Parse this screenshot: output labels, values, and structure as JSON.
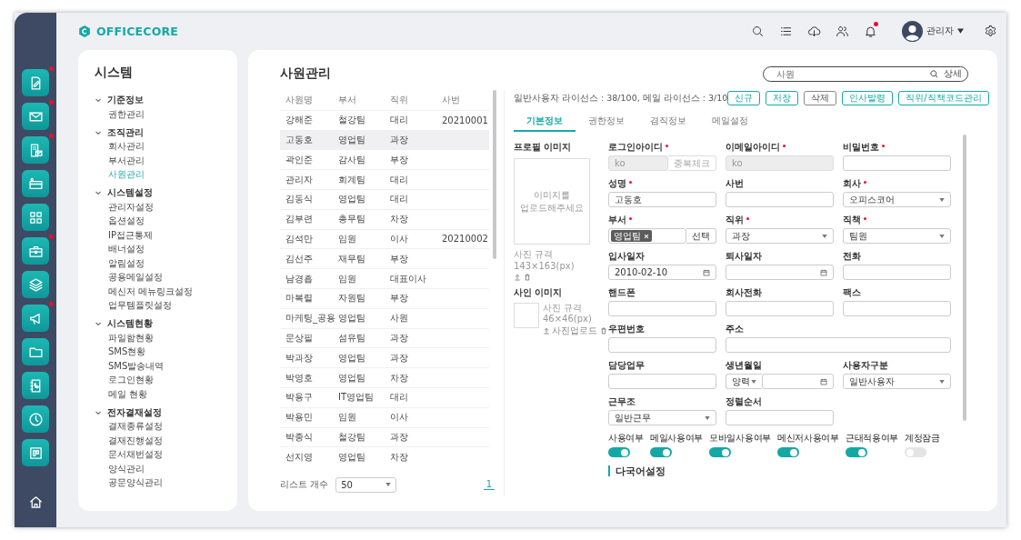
{
  "rail": [
    {
      "kind": "note",
      "badge": true
    },
    {
      "kind": "mail",
      "badge": true
    },
    {
      "kind": "building-mail",
      "badge": true
    },
    {
      "kind": "card",
      "badge": false
    },
    {
      "kind": "apps",
      "badge": false
    },
    {
      "kind": "briefcase",
      "badge": true
    },
    {
      "kind": "layers",
      "badge": false
    },
    {
      "kind": "megaphone",
      "badge": true
    },
    {
      "kind": "folder",
      "badge": false
    },
    {
      "kind": "contacts",
      "badge": false
    },
    {
      "kind": "clock",
      "badge": false
    },
    {
      "kind": "board",
      "badge": false
    }
  ],
  "header": {
    "logo": "OFFICECORE",
    "bell_badge": true,
    "user": "관리자"
  },
  "sidebar": {
    "title": "시스템",
    "items": [
      {
        "label": "기준정보",
        "expanded": true,
        "children": [
          {
            "label": "권한관리",
            "selected": false
          }
        ]
      },
      {
        "label": "조직관리",
        "expanded": true,
        "children": [
          {
            "label": "회사관리",
            "selected": false
          },
          {
            "label": "부서관리",
            "selected": false
          },
          {
            "label": "사원관리",
            "selected": true
          }
        ]
      },
      {
        "label": "시스템설정",
        "expanded": true,
        "children": [
          {
            "label": "관리자설정",
            "selected": false
          },
          {
            "label": "옵션설정",
            "selected": false
          },
          {
            "label": "IP접근통제",
            "selected": false
          },
          {
            "label": "배너설정",
            "selected": false
          },
          {
            "label": "알림설정",
            "selected": false
          },
          {
            "label": "공용메일설정",
            "selected": false
          },
          {
            "label": "메신저 메뉴링크설정",
            "selected": false
          },
          {
            "label": "업무템플릿설정",
            "selected": false
          }
        ]
      },
      {
        "label": "시스템현황",
        "expanded": true,
        "children": [
          {
            "label": "파일함현황",
            "selected": false
          },
          {
            "label": "SMS현황",
            "selected": false
          },
          {
            "label": "SMS발송내역",
            "selected": false
          },
          {
            "label": "로그인현황",
            "selected": false
          },
          {
            "label": "메일 현황",
            "selected": false
          }
        ]
      },
      {
        "label": "전자결재설정",
        "expanded": true,
        "children": [
          {
            "label": "결재종류설정",
            "selected": false
          },
          {
            "label": "결재진행설정",
            "selected": false
          },
          {
            "label": "문서채번설정",
            "selected": false
          },
          {
            "label": "양식관리",
            "selected": false
          },
          {
            "label": "공문양식관리",
            "selected": false
          }
        ]
      }
    ]
  },
  "page": {
    "title": "사원관리",
    "search": {
      "placeholder": "사원",
      "detail": "상세"
    }
  },
  "list": {
    "columns": [
      "사원명",
      "부서",
      "직위",
      "사번"
    ],
    "rows": [
      {
        "cells": [
          "강해준",
          "철강팀",
          "대리",
          "20210001"
        ],
        "selected": false
      },
      {
        "cells": [
          "고동호",
          "영업팀",
          "과장"
        ],
        "selected": true
      },
      {
        "cells": [
          "곽인준",
          "감사팀",
          "부장"
        ],
        "selected": false
      },
      {
        "cells": [
          "관리자",
          "회계팀",
          "대리"
        ],
        "selected": false
      },
      {
        "cells": [
          "김동식",
          "영업팀",
          "대리"
        ],
        "selected": false
      },
      {
        "cells": [
          "김부련",
          "총무팀",
          "차장"
        ],
        "selected": false
      },
      {
        "cells": [
          "김석만",
          "임원",
          "이사",
          "20210002"
        ],
        "selected": false
      },
      {
        "cells": [
          "김선주",
          "재무팀",
          "부장"
        ],
        "selected": false
      },
      {
        "cells": [
          "남경흡",
          "임원",
          "대표이사"
        ],
        "selected": false
      },
      {
        "cells": [
          "마복렬",
          "자원팀",
          "부장"
        ],
        "selected": false
      },
      {
        "cells": [
          "마케팅_공용",
          "영업팀",
          "사원"
        ],
        "selected": false
      },
      {
        "cells": [
          "문상필",
          "섬유팀",
          "과장"
        ],
        "selected": false
      },
      {
        "cells": [
          "박과장",
          "영업팀",
          "과장"
        ],
        "selected": false
      },
      {
        "cells": [
          "박영호",
          "영업팀",
          "차장"
        ],
        "selected": false
      },
      {
        "cells": [
          "박용구",
          "IT영업팀",
          "대리"
        ],
        "selected": false
      },
      {
        "cells": [
          "박용민",
          "임원",
          "이사"
        ],
        "selected": false
      },
      {
        "cells": [
          "박종식",
          "철강팀",
          "과장"
        ],
        "selected": false
      },
      {
        "cells": [
          "선지영",
          "영업팀",
          "차장"
        ],
        "selected": false
      }
    ],
    "footer": {
      "label": "리스트 개수",
      "page_size": "50",
      "pages": [
        {
          "label": "1",
          "selected": true
        }
      ]
    }
  },
  "form": {
    "license": "일반사용자 라이선스 : 38/100, 메일 라이선스 : 3/10",
    "buttons": [
      {
        "label": "신규",
        "kind": "accent"
      },
      {
        "label": "저장",
        "kind": "accent"
      },
      {
        "label": "삭제",
        "kind": "plain"
      },
      {
        "label": "인사발령",
        "kind": "accent"
      },
      {
        "label": "직위/직책코드관리",
        "kind": "accent"
      }
    ],
    "tabs": [
      {
        "label": "기본정보",
        "selected": true
      },
      {
        "label": "권한정보",
        "selected": false
      },
      {
        "label": "겸직정보",
        "selected": false
      },
      {
        "label": "메일설정",
        "selected": false
      }
    ],
    "profile": {
      "label": "프로필 이미지",
      "hint": "이미지를 업로드해주세요",
      "spec": "사진 규격 143×163(px)"
    },
    "sign": {
      "label": "사인 이미지",
      "spec": "사진 규격 46×46(px)",
      "upload": "사진업로드"
    },
    "fields": [
      {
        "label": "로그인아이디",
        "required": true,
        "kind": "id-check",
        "value": "ko",
        "disabled": true,
        "button": "중복체크"
      },
      {
        "label": "이메일아이디",
        "required": true,
        "kind": "text",
        "value": "ko",
        "disabled": true
      },
      {
        "label": "비밀번호",
        "required": true,
        "kind": "text",
        "disabled": false
      },
      {
        "label": "성명",
        "required": true,
        "kind": "text",
        "value": "고동호",
        "disabled": false
      },
      {
        "label": "사번",
        "required": false,
        "kind": "text",
        "disabled": false
      },
      {
        "label": "회사",
        "required": true,
        "kind": "select",
        "value": "오피스코어",
        "disabled": false
      },
      {
        "label": "부서",
        "required": true,
        "kind": "tag",
        "value": "영업팀",
        "button": "선택",
        "disabled": false
      },
      {
        "label": "직위",
        "required": true,
        "kind": "select",
        "value": "과장",
        "disabled": false
      },
      {
        "label": "직책",
        "required": true,
        "kind": "select",
        "value": "팀원",
        "disabled": false
      },
      {
        "label": "입사일자",
        "required": false,
        "kind": "date",
        "value": "2010-02-10",
        "disabled": false
      },
      {
        "label": "퇴사일자",
        "required": false,
        "kind": "date",
        "disabled": false
      },
      {
        "label": "전화",
        "required": false,
        "kind": "text",
        "disabled": false
      },
      {
        "label": "핸드폰",
        "required": false,
        "kind": "text",
        "disabled": false
      },
      {
        "label": "회사전화",
        "required": false,
        "kind": "text",
        "disabled": false
      },
      {
        "label": "팩스",
        "required": false,
        "kind": "text",
        "disabled": false
      },
      {
        "label": "우편번호",
        "required": false,
        "kind": "text",
        "disabled": false
      },
      {
        "label": "주소",
        "required": false,
        "kind": "long-text",
        "disabled": false
      },
      {
        "label": "담당업무",
        "required": false,
        "kind": "text",
        "disabled": false
      },
      {
        "label": "생년월일",
        "required": false,
        "kind": "calendar-date",
        "calendar": "양력",
        "disabled": false
      },
      {
        "label": "사용자구분",
        "required": false,
        "kind": "select",
        "value": "일반사용자",
        "disabled": false
      },
      {
        "label": "근무조",
        "required": false,
        "kind": "select",
        "value": "일반근무",
        "disabled": false
      },
      {
        "label": "정렬순서",
        "required": false,
        "kind": "text",
        "disabled": false
      }
    ],
    "toggles": [
      {
        "label": "사용여부",
        "on": true
      },
      {
        "label": "메일사용여부",
        "on": true
      },
      {
        "label": "모바일사용여부",
        "on": true
      },
      {
        "label": "메신저사용여부",
        "on": true
      },
      {
        "label": "근태적용여부",
        "on": true
      },
      {
        "label": "계정잠금",
        "on": false
      }
    ],
    "section": "다국어설정"
  }
}
